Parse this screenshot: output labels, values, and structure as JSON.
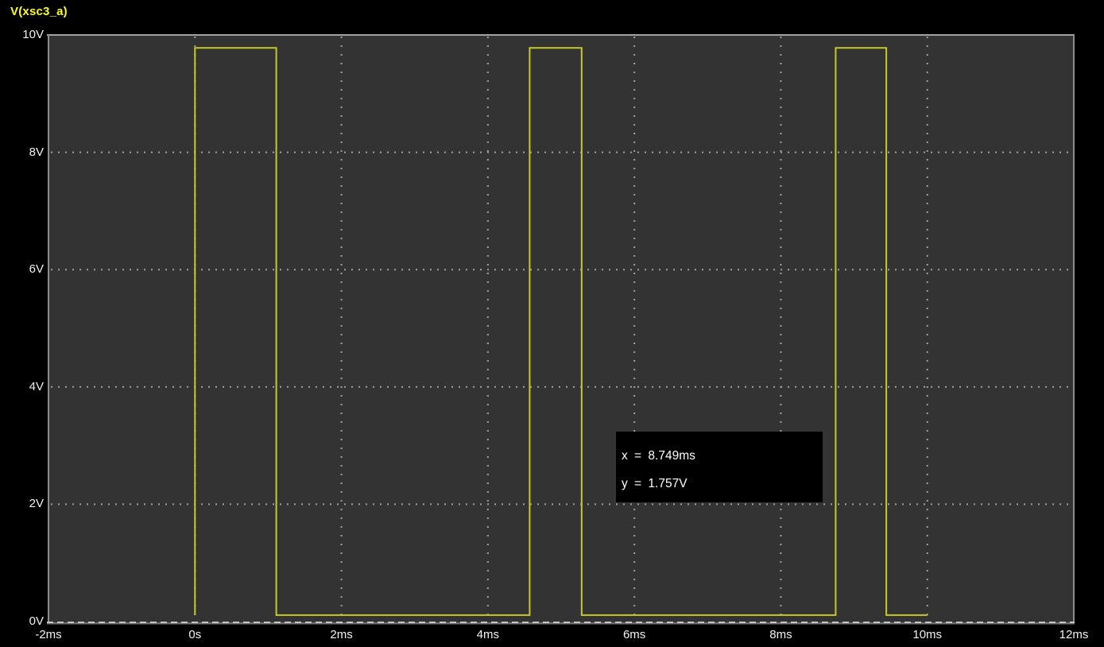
{
  "legend": {
    "label": "V(xsc3_a)"
  },
  "cursor_tooltip": {
    "x_line": "x = 8.749ms",
    "y_line": "y = 1.757V"
  },
  "colors": {
    "outer_background": "#000000",
    "plot_background": "#333333",
    "legend_text": "#ffff00",
    "trace": "#c8c828",
    "grid_dots": "#a2a2a2",
    "border": "#8c8c8c",
    "border_top": "#a2a2a2",
    "border_bottom_solid": "#6e6e6e",
    "border_bottom_dash": "#c6c6c6",
    "axis_text": "#f2f2f2",
    "tooltip_background": "#000000",
    "tooltip_text": "#ffffff"
  },
  "chart_data": {
    "type": "line",
    "title": "V(xsc3_a)",
    "subtitle": "",
    "xlabel": "",
    "ylabel": "",
    "grid": "dotted",
    "legend_position": "top-left",
    "x_axis": {
      "range": [
        -2,
        12
      ],
      "unit": "ms",
      "ticks": [
        -2,
        0,
        2,
        4,
        6,
        8,
        10,
        12
      ],
      "tick_labels": [
        "-2ms",
        "0s",
        "2ms",
        "4ms",
        "6ms",
        "8ms",
        "10ms",
        "12ms"
      ]
    },
    "y_axis": {
      "range": [
        0,
        10
      ],
      "unit": "V",
      "ticks": [
        0,
        2,
        4,
        6,
        8,
        10
      ],
      "tick_labels": [
        "0V",
        "2V",
        "4V",
        "6V",
        "8V",
        "10V"
      ]
    },
    "series": [
      {
        "name": "V(xsc3_a)",
        "shape": "square-wave",
        "high_level_V": 9.78,
        "low_level_V": 0.11,
        "points": [
          [
            0.0,
            0.11
          ],
          [
            0.0,
            9.78
          ],
          [
            1.11,
            9.78
          ],
          [
            1.11,
            0.11
          ],
          [
            4.57,
            0.11
          ],
          [
            4.57,
            9.78
          ],
          [
            5.28,
            9.78
          ],
          [
            5.28,
            0.11
          ],
          [
            8.749,
            0.11
          ],
          [
            8.749,
            9.78
          ],
          [
            9.44,
            9.78
          ],
          [
            9.44,
            0.11
          ],
          [
            10.0,
            0.11
          ]
        ]
      }
    ],
    "cursor": {
      "x_ms": 8.749,
      "y_V": 1.757
    }
  }
}
